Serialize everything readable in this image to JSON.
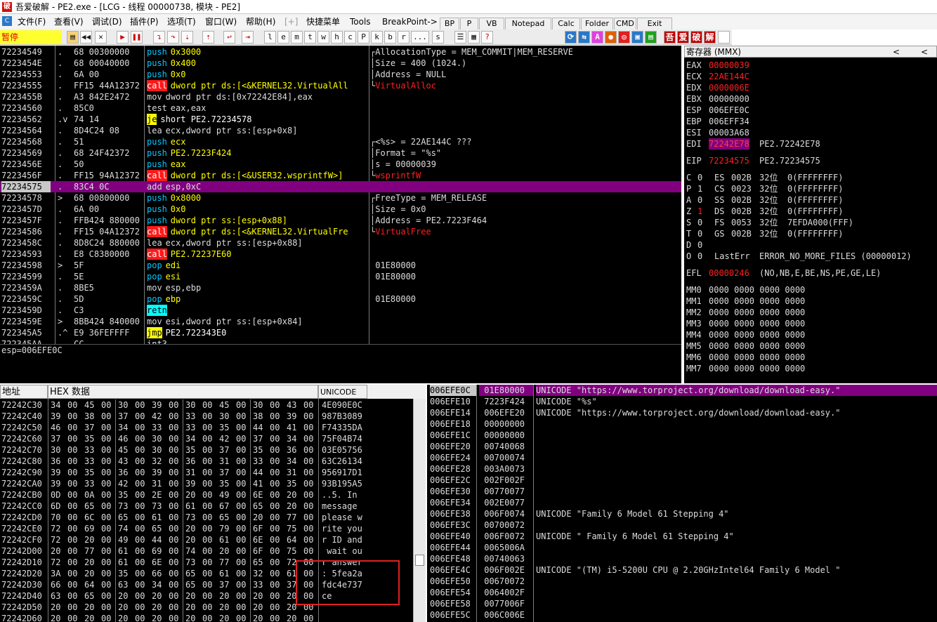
{
  "title": "吾爱破解 - PE2.exe - [LCG - 线程 00000738, 模块 - PE2]",
  "title_logo": "破",
  "menu": [
    "文件(F)",
    "查看(V)",
    "调试(D)",
    "插件(P)",
    "选项(T)",
    "窗口(W)",
    "帮助(H)",
    "[+]",
    "快捷菜单",
    "Tools",
    "BreakPoint->"
  ],
  "menu_tools": [
    "BP",
    "P",
    "VB",
    "Notepad",
    "Calc",
    "Folder",
    "CMD",
    "Exit"
  ],
  "status": "暂停",
  "toolbar_letters": [
    "l",
    "e",
    "m",
    "t",
    "w",
    "h",
    "c",
    "P",
    "k",
    "b",
    "r",
    "...",
    "s"
  ],
  "toolbar_icons": [
    "open-icon",
    "rewind-icon",
    "close-icon",
    "run-icon",
    "pause-icon",
    "step-into-icon",
    "step-over-icon",
    "trace-into-icon",
    "trace-over-icon",
    "execute-till-return-icon",
    "go-to-icon"
  ],
  "toolbar_right": [
    "吾",
    "爱",
    "破",
    "解"
  ],
  "disasm": [
    {
      "addr": "72234549",
      "mk": ".",
      "hex": "68 00300000",
      "mn": "push",
      "ops": "0x3000",
      "k": "W"
    },
    {
      "addr": "7223454E",
      "mk": ".",
      "hex": "68 00040000",
      "mn": "push",
      "ops": "0x400",
      "k": "W"
    },
    {
      "addr": "72234553",
      "mk": ".",
      "hex": "6A 00",
      "mn": "push",
      "ops": "0x0",
      "k": "W"
    },
    {
      "addr": "72234555",
      "mk": ".",
      "hex": "FF15 44A12372",
      "mn": "call",
      "ops": "dword ptr ds:[<&KERNEL32.VirtualAll",
      "k": "C"
    },
    {
      "addr": "7223455B",
      "mk": ".",
      "hex": "A3 842E2472",
      "mn": "mov",
      "ops": "dword ptr ds:[0x72242E84],eax",
      "k": "N"
    },
    {
      "addr": "72234560",
      "mk": ".",
      "hex": "85C0",
      "mn": "test",
      "ops": "eax,eax",
      "k": "N"
    },
    {
      "addr": "72234562",
      "mk": ".v",
      "hex": "74 14",
      "mn": "je",
      "ops": "short PE2.72234578",
      "k": "J"
    },
    {
      "addr": "72234564",
      "mk": ".",
      "hex": "8D4C24 08",
      "mn": "lea",
      "ops": "ecx,dword ptr ss:[esp+0x8]",
      "k": "N"
    },
    {
      "addr": "72234568",
      "mk": ".",
      "hex": "51",
      "mn": "push",
      "ops": "ecx",
      "k": "W"
    },
    {
      "addr": "72234569",
      "mk": ".",
      "hex": "68 24F42372",
      "mn": "push",
      "ops": "PE2.7223F424",
      "k": "W"
    },
    {
      "addr": "7223456E",
      "mk": ".",
      "hex": "50",
      "mn": "push",
      "ops": "eax",
      "k": "W"
    },
    {
      "addr": "7223456F",
      "mk": ".",
      "hex": "FF15 94A12372",
      "mn": "call",
      "ops": "dword ptr ds:[<&USER32.wsprintfW>]",
      "k": "C"
    },
    {
      "addr": "72234575",
      "mk": ".",
      "hex": "83C4 0C",
      "mn": "add",
      "ops": "esp,0xC",
      "k": "N",
      "sel": true
    },
    {
      "addr": "72234578",
      "mk": ">",
      "hex": "68 00800000",
      "mn": "push",
      "ops": "0x8000",
      "k": "W"
    },
    {
      "addr": "7223457D",
      "mk": ".",
      "hex": "6A 00",
      "mn": "push",
      "ops": "0x0",
      "k": "W"
    },
    {
      "addr": "7223457F",
      "mk": ".",
      "hex": "FFB424 880000",
      "mn": "push",
      "ops": "dword ptr ss:[esp+0x88]",
      "k": "W"
    },
    {
      "addr": "72234586",
      "mk": ".",
      "hex": "FF15 04A12372",
      "mn": "call",
      "ops": "dword ptr ds:[<&KERNEL32.VirtualFre",
      "k": "C"
    },
    {
      "addr": "7223458C",
      "mk": ".",
      "hex": "8D8C24 880000",
      "mn": "lea",
      "ops": "ecx,dword ptr ss:[esp+0x88]",
      "k": "N"
    },
    {
      "addr": "72234593",
      "mk": ".",
      "hex": "E8 C8380000",
      "mn": "call",
      "ops": "PE2.72237E60",
      "k": "C"
    },
    {
      "addr": "72234598",
      "mk": ">",
      "hex": "5F",
      "mn": "pop",
      "ops": "edi",
      "k": "W"
    },
    {
      "addr": "72234599",
      "mk": ".",
      "hex": "5E",
      "mn": "pop",
      "ops": "esi",
      "k": "W"
    },
    {
      "addr": "7223459A",
      "mk": ".",
      "hex": "8BE5",
      "mn": "mov",
      "ops": "esp,ebp",
      "k": "N"
    },
    {
      "addr": "7223459C",
      "mk": ".",
      "hex": "5D",
      "mn": "pop",
      "ops": "ebp",
      "k": "W"
    },
    {
      "addr": "7223459D",
      "mk": ".",
      "hex": "C3",
      "mn": "retn",
      "ops": "",
      "k": "R"
    },
    {
      "addr": "7223459E",
      "mk": ">",
      "hex": "8BB424 840000",
      "mn": "mov",
      "ops": "esi,dword ptr ss:[esp+0x84]",
      "k": "N"
    },
    {
      "addr": "722345A5",
      "mk": ".^",
      "hex": "E9 36FEFFFF",
      "mn": "jmp",
      "ops": "PE2.722343E0",
      "k": "J"
    },
    {
      "addr": "722345AA",
      "mk": "",
      "hex": "CC",
      "mn": "int3",
      "ops": "",
      "k": "N"
    }
  ],
  "comments": [
    {
      "row": 0,
      "text": "AllocationType = MEM_COMMIT|MEM_RESERVE",
      "br": "┌"
    },
    {
      "row": 1,
      "text": "Size = 400 (1024.)",
      "br": "│"
    },
    {
      "row": 2,
      "text": "Address = NULL",
      "br": "│"
    },
    {
      "row": 3,
      "text": "VirtualAlloc",
      "br": "└",
      "red": true
    },
    {
      "row": 8,
      "text": "<%s> = 22AE144C ???",
      "br": "┌"
    },
    {
      "row": 9,
      "text": "Format = \"%s\"",
      "br": "│"
    },
    {
      "row": 10,
      "text": "s = 00000039",
      "br": "│"
    },
    {
      "row": 11,
      "text": "wsprintfW",
      "br": "└",
      "red": true
    },
    {
      "row": 13,
      "text": "FreeType = MEM_RELEASE",
      "br": "┌"
    },
    {
      "row": 14,
      "text": "Size = 0x0",
      "br": "│"
    },
    {
      "row": 15,
      "text": "Address = PE2.7223F464",
      "br": "│"
    },
    {
      "row": 16,
      "text": "VirtualFree",
      "br": "└",
      "red": true
    },
    {
      "row": 19,
      "text": " 01E80000",
      "br": ""
    },
    {
      "row": 20,
      "text": " 01E80000",
      "br": ""
    },
    {
      "row": 22,
      "text": " 01E80000",
      "br": ""
    }
  ],
  "info": "esp=006EFE0C",
  "registers": {
    "header": "寄存器 (MMX)",
    "nav": [
      "<",
      "<"
    ],
    "regs": [
      {
        "n": "EAX",
        "v": "00000039",
        "c": "red"
      },
      {
        "n": "ECX",
        "v": "22AE144C",
        "c": "red"
      },
      {
        "n": "EDX",
        "v": "0000006E",
        "c": "red"
      },
      {
        "n": "EBX",
        "v": "00000000",
        "c": ""
      },
      {
        "n": "ESP",
        "v": "006EFE0C",
        "c": ""
      },
      {
        "n": "EBP",
        "v": "006EFF34",
        "c": ""
      },
      {
        "n": "ESI",
        "v": "00003A68",
        "c": ""
      },
      {
        "n": "EDI",
        "v": "72242E78",
        "c": "sel",
        "x": "PE2.72242E78"
      }
    ],
    "eip": {
      "n": "EIP",
      "v": "72234575",
      "x": "PE2.72234575"
    },
    "flags": [
      {
        "f": "C",
        "b": "0",
        "s": "ES",
        "sel": "002B",
        "w": "32位",
        "r": "0(FFFFFFFF)"
      },
      {
        "f": "P",
        "b": "1",
        "s": "CS",
        "sel": "0023",
        "w": "32位",
        "r": "0(FFFFFFFF)"
      },
      {
        "f": "A",
        "b": "0",
        "s": "SS",
        "sel": "002B",
        "w": "32位",
        "r": "0(FFFFFFFF)"
      },
      {
        "f": "Z",
        "b": "1",
        "s": "DS",
        "sel": "002B",
        "w": "32位",
        "r": "0(FFFFFFFF)",
        "red": true
      },
      {
        "f": "S",
        "b": "0",
        "s": "FS",
        "sel": "0053",
        "w": "32位",
        "r": "7EFDA000(FFF)"
      },
      {
        "f": "T",
        "b": "0",
        "s": "GS",
        "sel": "002B",
        "w": "32位",
        "r": "0(FFFFFFFF)"
      },
      {
        "f": "D",
        "b": "0",
        "s": "",
        "sel": "",
        "w": "",
        "r": ""
      },
      {
        "f": "O",
        "b": "0",
        "s": "LastErr",
        "sel": "ERROR_NO_MORE_FILES (00000012)",
        "w": "",
        "r": ""
      }
    ],
    "efl": {
      "n": "EFL",
      "v": "00000246",
      "x": "(NO,NB,E,BE,NS,PE,GE,LE)"
    },
    "mmx": [
      {
        "n": "MM0",
        "v": "0000 0000 0000 0000"
      },
      {
        "n": "MM1",
        "v": "0000 0000 0000 0000"
      },
      {
        "n": "MM2",
        "v": "0000 0000 0000 0000"
      },
      {
        "n": "MM3",
        "v": "0000 0000 0000 0000"
      },
      {
        "n": "MM4",
        "v": "0000 0000 0000 0000"
      },
      {
        "n": "MM5",
        "v": "0000 0000 0000 0000"
      },
      {
        "n": "MM6",
        "v": "0000 0000 0000 0000"
      },
      {
        "n": "MM7",
        "v": "0000 0000 0000 0000"
      }
    ]
  },
  "dump": {
    "headers": [
      "地址",
      "HEX 数据",
      "UNICODE"
    ],
    "rows": [
      {
        "a": "72242C30",
        "h": "34 00 45 00 30 00 39 00 30 00 45 00 30 00 43 00",
        "u": "4E090E0C"
      },
      {
        "a": "72242C40",
        "h": "39 00 38 00 37 00 42 00 33 00 30 00 38 00 39 00",
        "u": "987B3089"
      },
      {
        "a": "72242C50",
        "h": "46 00 37 00 34 00 33 00 33 00 35 00 44 00 41 00",
        "u": "F74335DA"
      },
      {
        "a": "72242C60",
        "h": "37 00 35 00 46 00 30 00 34 00 42 00 37 00 34 00",
        "u": "75F04B74"
      },
      {
        "a": "72242C70",
        "h": "30 00 33 00 45 00 30 00 35 00 37 00 35 00 36 00",
        "u": "03E05756"
      },
      {
        "a": "72242C80",
        "h": "36 00 33 00 43 00 32 00 36 00 31 00 33 00 34 00",
        "u": "63C26134"
      },
      {
        "a": "72242C90",
        "h": "39 00 35 00 36 00 39 00 31 00 37 00 44 00 31 00",
        "u": "956917D1"
      },
      {
        "a": "72242CA0",
        "h": "39 00 33 00 42 00 31 00 39 00 35 00 41 00 35 00",
        "u": "93B195A5"
      },
      {
        "a": "72242CB0",
        "h": "0D 00 0A 00 35 00 2E 00 20 00 49 00 6E 00 20 00",
        "u": "..5. In"
      },
      {
        "a": "72242CC0",
        "h": "6D 00 65 00 73 00 73 00 61 00 67 00 65 00 20 00",
        "u": "message"
      },
      {
        "a": "72242CD0",
        "h": "70 00 6C 00 65 00 61 00 73 00 65 00 20 00 77 00",
        "u": "please w"
      },
      {
        "a": "72242CE0",
        "h": "72 00 69 00 74 00 65 00 20 00 79 00 6F 00 75 00",
        "u": "rite you"
      },
      {
        "a": "72242CF0",
        "h": "72 00 20 00 49 00 44 00 20 00 61 00 6E 00 64 00",
        "u": "r ID and"
      },
      {
        "a": "72242D00",
        "h": "20 00 77 00 61 00 69 00 74 00 20 00 6F 00 75 00",
        "u": " wait ou"
      },
      {
        "a": "72242D10",
        "h": "72 00 20 00 61 00 6E 00 73 00 77 00 65 00 72 00",
        "u": "r answer"
      },
      {
        "a": "72242D20",
        "h": "3A 00 20 00 35 00 66 00 65 00 61 00 32 00 61 00",
        "u": ": 5fea2a"
      },
      {
        "a": "72242D30",
        "h": "66 00 64 00 63 00 34 00 65 00 37 00 33 00 37 00",
        "u": "fdc4e737"
      },
      {
        "a": "72242D40",
        "h": "63 00 65 00 20 00 20 00 20 00 20 00 20 00 20 00",
        "u": "ce"
      },
      {
        "a": "72242D50",
        "h": "20 00 20 00 20 00 20 00 20 00 20 00 20 00 20 00",
        "u": ""
      },
      {
        "a": "72242D60",
        "h": "20 00 20 00 20 00 20 00 20 00 20 00 20 00 20 00",
        "u": ""
      }
    ]
  },
  "stack": [
    {
      "a": "006EFE0C",
      "v": "01E80000",
      "c": "UNICODE \"https://www.torproject.org/download/download-easy.\"",
      "sel": true
    },
    {
      "a": "006EFE10",
      "v": "7223F424",
      "c": "UNICODE \"%s\""
    },
    {
      "a": "006EFE14",
      "v": "006EFE20",
      "c": "UNICODE \"https://www.torproject.org/download/download-easy.\""
    },
    {
      "a": "006EFE18",
      "v": "00000000",
      "c": ""
    },
    {
      "a": "006EFE1C",
      "v": "00000000",
      "c": ""
    },
    {
      "a": "006EFE20",
      "v": "00740068",
      "c": ""
    },
    {
      "a": "006EFE24",
      "v": "00700074",
      "c": ""
    },
    {
      "a": "006EFE28",
      "v": "003A0073",
      "c": ""
    },
    {
      "a": "006EFE2C",
      "v": "002F002F",
      "c": ""
    },
    {
      "a": "006EFE30",
      "v": "00770077",
      "c": ""
    },
    {
      "a": "006EFE34",
      "v": "002E0077",
      "c": ""
    },
    {
      "a": "006EFE38",
      "v": "006F0074",
      "c": "UNICODE \"Family 6 Model 61 Stepping 4\""
    },
    {
      "a": "006EFE3C",
      "v": "00700072",
      "c": ""
    },
    {
      "a": "006EFE40",
      "v": "006F0072",
      "c": "UNICODE \" Family 6 Model 61 Stepping 4\""
    },
    {
      "a": "006EFE44",
      "v": "0065006A",
      "c": ""
    },
    {
      "a": "006EFE48",
      "v": "00740063",
      "c": ""
    },
    {
      "a": "006EFE4C",
      "v": "006F002E",
      "c": "UNICODE \"(TM) i5-5200U CPU @ 2.20GHzIntel64 Family 6 Model \""
    },
    {
      "a": "006EFE50",
      "v": "00670072",
      "c": ""
    },
    {
      "a": "006EFE54",
      "v": "0064002F",
      "c": ""
    },
    {
      "a": "006EFE58",
      "v": "0077006F",
      "c": ""
    },
    {
      "a": "006EFE5C",
      "v": "006C006E",
      "c": ""
    }
  ]
}
